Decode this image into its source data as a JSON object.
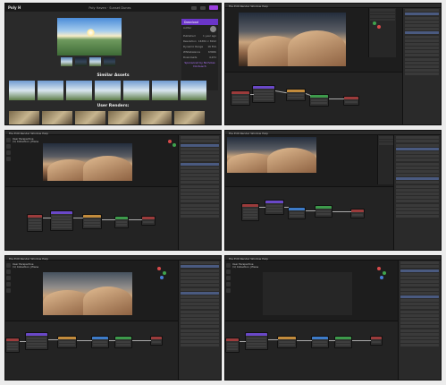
{
  "site": {
    "logo": "Poly H",
    "page_title": "Poly Haven · Sunset Dunes",
    "side_header": "Download",
    "side_rows": [
      [
        "Author",
        "Greg Zaal"
      ],
      [
        "Published",
        "1 year ago"
      ],
      [
        "Resolution",
        "16384 × 8192"
      ],
      [
        "Dynamic Range",
        "16 EVs"
      ],
      [
        "Whitebalance",
        "6300K"
      ],
      [
        "Downloads",
        "4,231"
      ]
    ],
    "side_purple": "Sponsored by Nicholas Dorbusch",
    "section_similar": "Similar Assets",
    "section_renders": "User Renders:",
    "colors": {
      "accent": "#9b3fe0",
      "header": "#6a35c8"
    }
  },
  "blender": {
    "menu": "File  Edit  Render  Window  Help",
    "view_label": "User Perspective",
    "collection_label": "(1) Collection | Plane"
  }
}
